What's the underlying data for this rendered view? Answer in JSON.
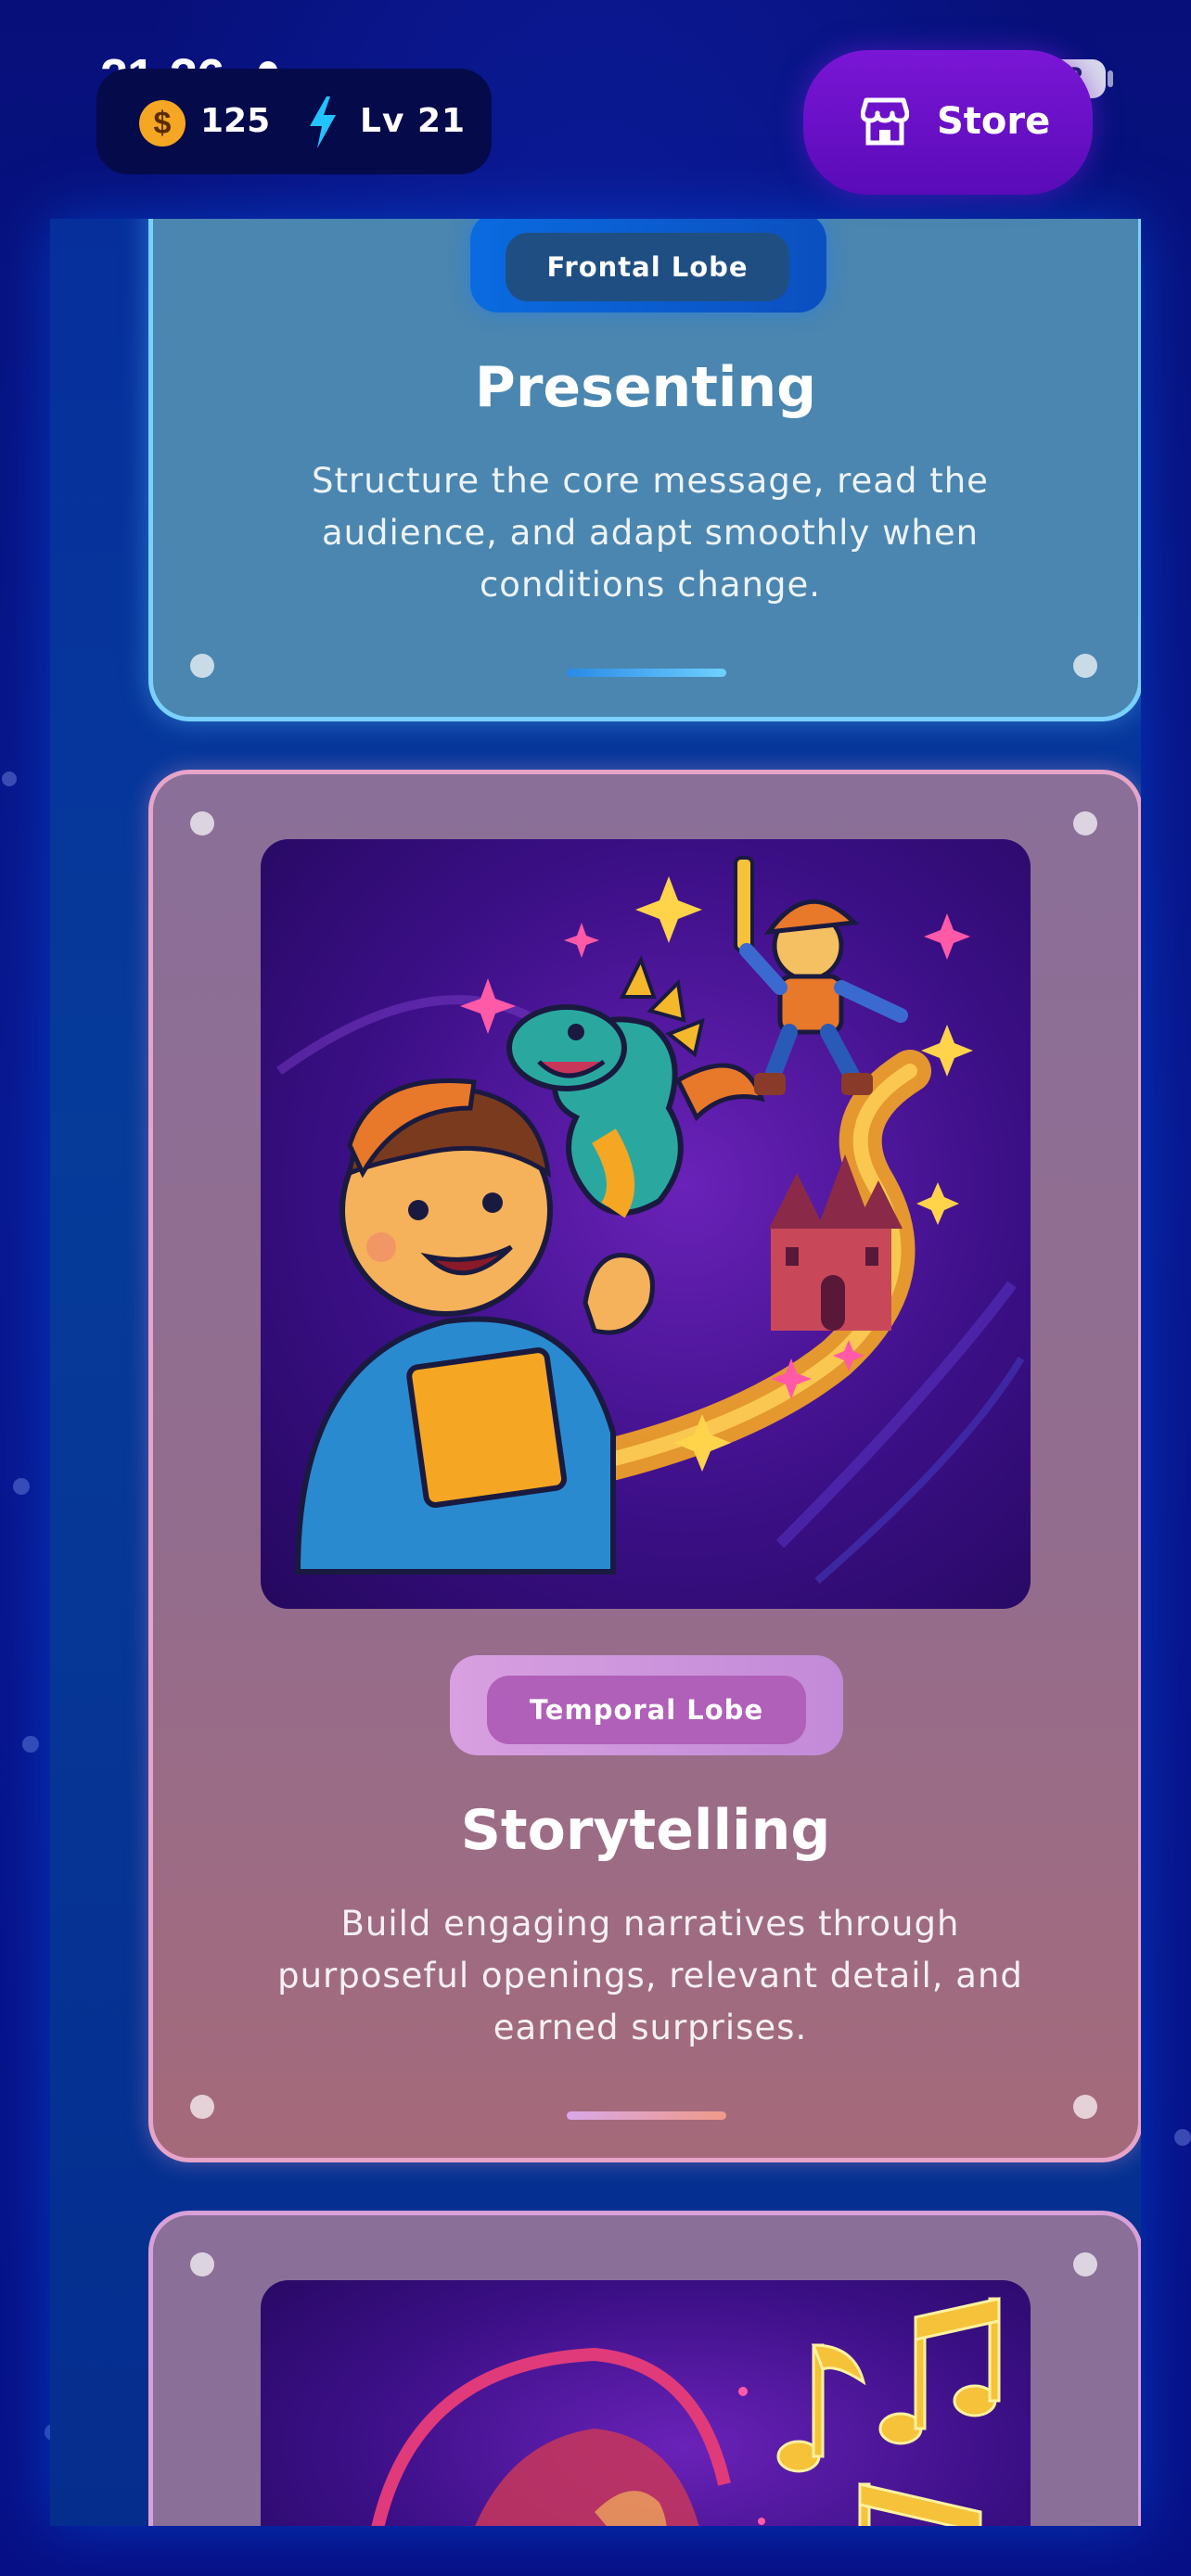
{
  "status_bar": {
    "time": "21:36",
    "battery": "53"
  },
  "stats": {
    "coin_symbol": "$",
    "coins": "125",
    "level": "Lv 21"
  },
  "store": {
    "label": "Store"
  },
  "cards": [
    {
      "tag": "Frontal Lobe",
      "title": "Presenting",
      "description_lines": [
        "Structure the core message, read the",
        "audience, and adapt smoothly when",
        "conditions change."
      ]
    },
    {
      "tag": "Temporal Lobe",
      "title": "Storytelling",
      "description_lines": [
        "Build engaging narratives through",
        "purposeful openings, relevant detail, and",
        "earned surprises."
      ]
    }
  ],
  "colors": {
    "background": "#07117a",
    "presenting_card": "#4a86b0",
    "presenting_border": "#7ad0ff",
    "story_card": "#936d8e",
    "story_border": "#e6a4c8",
    "store_button": "#6a10c8",
    "coin": "#f5a623",
    "bolt": "#22c3ff"
  },
  "icons": [
    "person-icon",
    "signal-icon",
    "wifi-icon",
    "coin-icon",
    "bolt-icon",
    "store-icon"
  ]
}
